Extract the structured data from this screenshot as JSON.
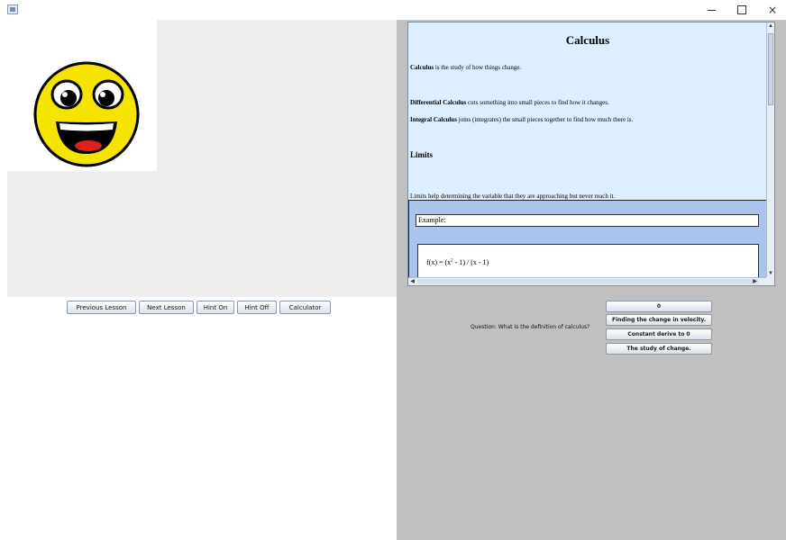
{
  "window": {
    "minimize": "–",
    "maximize": "",
    "close": "×"
  },
  "buttons": {
    "previous_lesson": "Previous Lesson",
    "next_lesson": "Next Lesson",
    "hint_on": "Hint On",
    "hint_off": "Hint Off",
    "calculator": "Calculator"
  },
  "lesson": {
    "title": "Calculus",
    "intro_bold": "Calculus",
    "intro_rest": " is the study of how things change.",
    "diff_bold": "Differential Calculus",
    "diff_rest": " cuts something into small pieces to find how it changes.",
    "int_bold": "Integral Calculus",
    "int_rest": " joins (integrates) the small pieces together to find how much there is.",
    "limits_heading": "Limits",
    "limits_text": "Limits help determining the variable that they are approaching but never reach it.",
    "example_label": "Example:",
    "formula_lhs": "f(x) = (x",
    "formula_exp": "2",
    "formula_rhs": " - 1) / (x - 1)"
  },
  "quiz": {
    "question": "Question: What is the definition of calculus?",
    "answers": [
      "0",
      "Finding the change in velocity.",
      "Constant derive to 0",
      "The study of change."
    ]
  },
  "colors": {
    "face_yellow": "#f5e400",
    "lesson_background": "#ddeeff",
    "example_background": "#aac4ee",
    "right_panel": "#c0c0c0"
  }
}
